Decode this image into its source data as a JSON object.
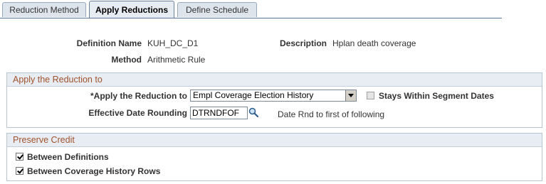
{
  "tabs": [
    {
      "label": "Reduction Method",
      "active": false
    },
    {
      "label": "Apply Reductions",
      "active": true
    },
    {
      "label": "Define Schedule",
      "active": false
    }
  ],
  "header": {
    "definition_name_label": "Definition Name",
    "definition_name_value": "KUH_DC_D1",
    "description_label": "Description",
    "description_value": "Hplan death coverage",
    "method_label": "Method",
    "method_value": "Arithmetic Rule"
  },
  "apply_group": {
    "title": "Apply the Reduction to",
    "apply_label": "*Apply the Reduction to",
    "apply_value": "Empl Coverage Election History",
    "stays_within_label": "Stays Within Segment Dates",
    "stays_within_checked": false,
    "rounding_label": "Effective Date Rounding",
    "rounding_value": "DTRNDFOF",
    "rounding_description": "Date Rnd to first of following"
  },
  "preserve_group": {
    "title": "Preserve Credit",
    "between_definitions_label": "Between Definitions",
    "between_definitions_checked": true,
    "between_history_label": "Between Coverage History Rows",
    "between_history_checked": true
  },
  "icons": {
    "lookup": "magnifier-lookup-icon",
    "dropdown": "chevron-down-icon"
  },
  "colors": {
    "group_title": "#a0522d",
    "group_header_bg": "#e8edf3",
    "tab_bg": "#dde4ec"
  }
}
